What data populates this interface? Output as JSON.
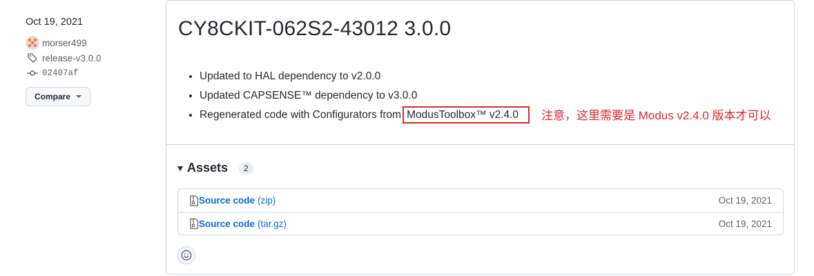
{
  "sidebar": {
    "date": "Oct 19, 2021",
    "author": "morser499",
    "tag": "release-v3.0.0",
    "commit": "02407af",
    "compare_label": "Compare"
  },
  "release": {
    "title": "CY8CKIT-062S2-43012 3.0.0",
    "notes": [
      "Updated to HAL dependency to v2.0.0",
      "Updated CAPSENSE™ dependency to v3.0.0"
    ],
    "note3_prefix": "Regenerated code with Configurators from",
    "note3_highlight": "ModusToolbox™ v2.4.0",
    "annotation": "注意，这里需要是 Modus v2.4.0 版本才可以"
  },
  "assets": {
    "heading": "Assets",
    "count": "2",
    "items": [
      {
        "label": "Source code",
        "ext": "(zip)",
        "date": "Oct 19, 2021",
        "icon": "file-zip-icon"
      },
      {
        "label": "Source code",
        "ext": "(tar.gz)",
        "date": "Oct 19, 2021",
        "icon": "file-zip-icon"
      }
    ]
  },
  "colors": {
    "accent_link": "#0969da",
    "annotation_red": "#e0262a",
    "border": "#d0d7de"
  }
}
